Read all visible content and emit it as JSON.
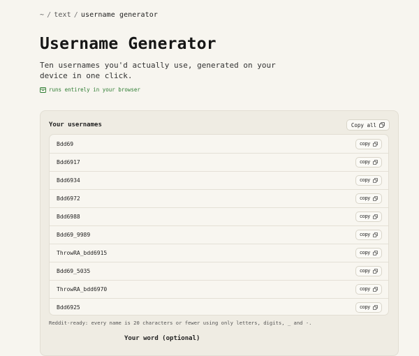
{
  "breadcrumb": {
    "root": "~",
    "section": "text",
    "current": "username generator"
  },
  "page": {
    "title": "Username Generator",
    "subtitle": "Ten usernames you'd actually use, generated on your device in one click.",
    "badge": "runs entirely in your browser"
  },
  "panel": {
    "title": "Your usernames",
    "copy_all_label": "Copy all",
    "copy_label": "copy",
    "usernames": [
      "Bdd69",
      "Bdd6917",
      "Bdd6934",
      "Bdd6972",
      "Bdd6988",
      "Bdd69_9989",
      "ThrowRA_bdd6915",
      "Bdd69_5035",
      "ThrowRA_bdd6970",
      "Bdd6925"
    ],
    "footnote": "Reddit-ready: every name is 20 characters or fewer using only letters, digits, _ and -.",
    "word_label": "Your word (optional)"
  },
  "colors": {
    "background": "#f7f5ef",
    "panel": "#efece3",
    "accent_green": "#2e7d32"
  },
  "icons": {
    "badge": "browser-icon",
    "copy": "copy-icon"
  }
}
